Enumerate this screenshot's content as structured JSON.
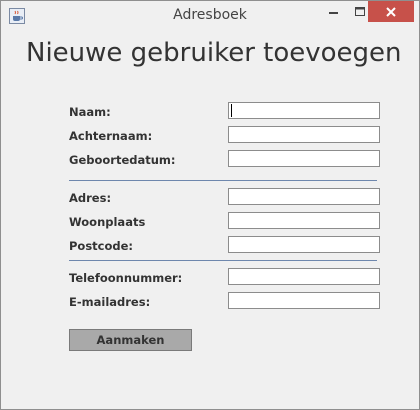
{
  "window": {
    "title": "Adresboek"
  },
  "form": {
    "heading": "Nieuwe gebruiker toevoegen",
    "fields": {
      "naam": {
        "label": "Naam:",
        "value": ""
      },
      "achternaam": {
        "label": "Achternaam:",
        "value": ""
      },
      "geboortedatum": {
        "label": "Geboortedatum:",
        "value": ""
      },
      "adres": {
        "label": "Adres:",
        "value": ""
      },
      "woonplaats": {
        "label": "Woonplaats",
        "value": ""
      },
      "postcode": {
        "label": "Postcode:",
        "value": ""
      },
      "telefoonnummer": {
        "label": "Telefoonnummer:",
        "value": ""
      },
      "emailadres": {
        "label": "E-mailadres:",
        "value": ""
      }
    },
    "submit_label": "Aanmaken"
  },
  "icons": {
    "app": "java-coffee-cup-icon",
    "minimize": "minimize-icon",
    "maximize": "maximize-icon",
    "close": "close-icon"
  },
  "colors": {
    "close_button": "#c7514a",
    "separator": "#6e87ad",
    "submit_button": "#a9a9a9"
  }
}
